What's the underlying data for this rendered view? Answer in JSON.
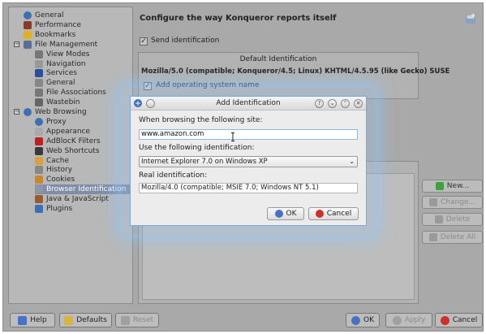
{
  "tree": {
    "items": [
      {
        "label": "General",
        "icon": "globe-icon",
        "color": "#3d6fb6"
      },
      {
        "label": "Performance",
        "icon": "rocket-icon",
        "color": "#8a3a2a"
      },
      {
        "label": "Bookmarks",
        "icon": "star-icon",
        "color": "#e2b21c"
      },
      {
        "label": "File Management",
        "icon": "folder-icon",
        "color": "#5a6f95"
      },
      {
        "label": "View Modes",
        "icon": "view-icon",
        "color": "#777"
      },
      {
        "label": "Navigation",
        "icon": "mouse-icon",
        "color": "#999"
      },
      {
        "label": "Services",
        "icon": "flag-icon",
        "color": "#2a4f9a"
      },
      {
        "label": "General",
        "icon": "gear-icon",
        "color": "#888"
      },
      {
        "label": "File Associations",
        "icon": "file-assoc-icon",
        "color": "#777"
      },
      {
        "label": "Wastebin",
        "icon": "trash-icon",
        "color": "#666"
      },
      {
        "label": "Web Browsing",
        "icon": "globe-icon",
        "color": "#3d6fb6"
      },
      {
        "label": "Proxy",
        "icon": "globe-icon",
        "color": "#3d6fb6"
      },
      {
        "label": "Appearance",
        "icon": "brush-icon",
        "color": "#aaa"
      },
      {
        "label": "AdBlocK Filters",
        "icon": "stop-icon",
        "color": "#c02020"
      },
      {
        "label": "Web Shortcuts",
        "icon": "shortcut-icon",
        "color": "#3a3a3a"
      },
      {
        "label": "Cache",
        "icon": "disk-icon",
        "color": "#d9a23a"
      },
      {
        "label": "History",
        "icon": "history-icon",
        "color": "#888"
      },
      {
        "label": "Cookies",
        "icon": "cookie-icon",
        "color": "#c8892e"
      },
      {
        "label": "Browser Identification",
        "icon": "browser-id-icon",
        "color": "#8c96a8"
      },
      {
        "label": "Java & JavaScript",
        "icon": "java-icon",
        "color": "#9a5a2a"
      },
      {
        "label": "Plugins",
        "icon": "plugin-icon",
        "color": "#3d6fb6"
      }
    ]
  },
  "main": {
    "title": "Configure the way Konqueror reports itself",
    "send_identification": "Send identification",
    "default_identification_header": "Default Identification",
    "user_agent": "Mozilla/5.0 (compatible; Konqueror/4.5; Linux) KHTML/4.5.95 (like Gecko) SUSE",
    "add_os_name": "Add operating system name"
  },
  "side_buttons": {
    "new": "New...",
    "change": "Change...",
    "delete": "Delete",
    "delete_all": "Delete All"
  },
  "bottom_buttons": {
    "help": "Help",
    "defaults": "Defaults",
    "reset": "Reset",
    "ok": "OK",
    "apply": "Apply",
    "cancel": "Cancel"
  },
  "dialog": {
    "title": "Add Identification",
    "site_label": "When browsing the following site:",
    "site_value": "www.amazon.com",
    "ident_label": "Use the following identification:",
    "ident_selected": "Internet Explorer 7.0 on Windows XP",
    "real_label": "Real identification:",
    "real_value": "Mozilla/4.0 (compatible; MSIE 7.0; Windows NT 5.1)",
    "ok": "OK",
    "cancel": "Cancel"
  },
  "colors": {
    "window_bg": "#a9a9a9",
    "selection": "#7f8ea6",
    "dialog_glow": "#8cc8ff",
    "ok_icon": "#4a72c4",
    "cancel_icon": "#d0302a",
    "new_icon": "#3aa33a"
  }
}
